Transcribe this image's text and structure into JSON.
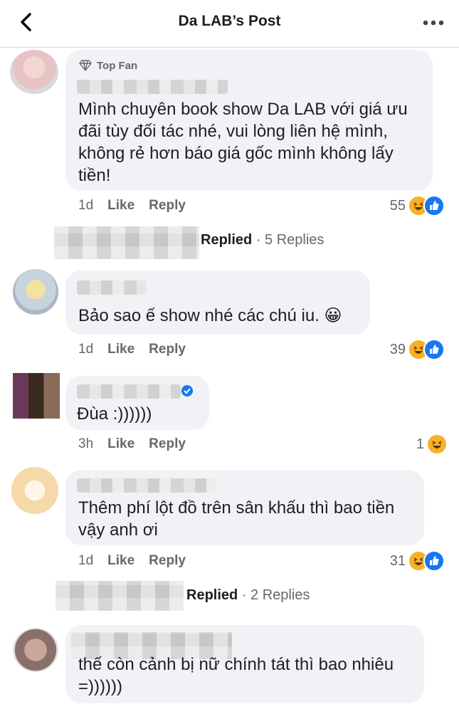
{
  "header": {
    "title": "Da LAB’s Post"
  },
  "comments": [
    {
      "badge": "Top Fan",
      "text": [
        "Mình chuyên book show Da LAB với giá ưu",
        "đãi tùy đối tác nhé, vui lòng liên hệ mình,",
        "không rẻ hơn báo giá gốc mình không lấy",
        "tiền!"
      ],
      "time": "1d",
      "like": "Like",
      "reply": "Reply",
      "reactions": "55",
      "replies": {
        "prefix": "Replied",
        "count": "· 5 Replies"
      }
    },
    {
      "text": [
        "Bảo sao ế show nhé các chú iu. 😀"
      ],
      "time": "1d",
      "like": "Like",
      "reply": "Reply",
      "reactions": "39"
    },
    {
      "text": [
        "Đùa :))))))"
      ],
      "time": "3h",
      "like": "Like",
      "reply": "Reply",
      "reactions": "1"
    },
    {
      "text": [
        "Thêm phí lột đồ trên sân khấu thì bao tiền",
        "vậy anh ơi"
      ],
      "time": "1d",
      "like": "Like",
      "reply": "Reply",
      "reactions": "31",
      "replies": {
        "prefix": "Replied",
        "count": "· 2 Replies"
      }
    },
    {
      "text": [
        "thế còn cảnh bị nữ chính tát thì bao nhiêu",
        "=))))))"
      ]
    }
  ],
  "icons": {
    "back": "chevron-left-icon",
    "more": "more-dots-icon",
    "top_fan": "diamond-icon",
    "verified": "verified-badge-icon",
    "haha": "haha-reaction-icon",
    "like": "like-reaction-icon"
  }
}
